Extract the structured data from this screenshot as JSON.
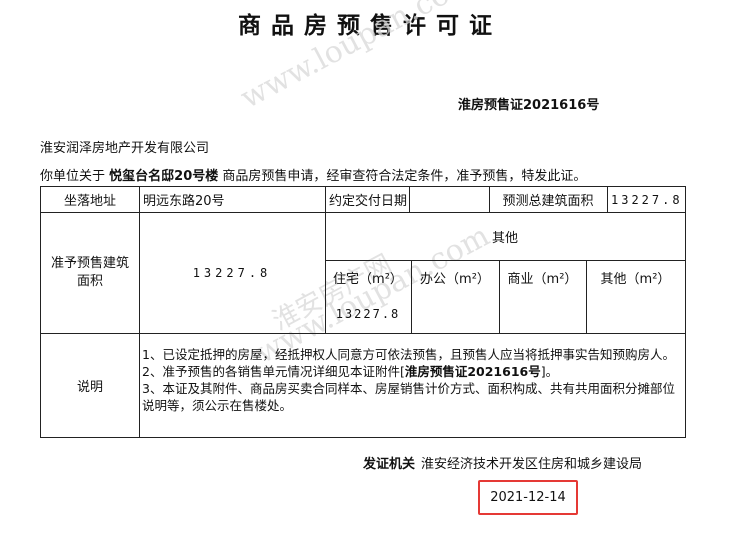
{
  "document": {
    "title": "商品房预售许可证",
    "cert_number": "淮房预售证2021616号",
    "company": "淮安润泽房地产开发有限公司",
    "intro_prefix": "你单位关于",
    "project": "悦玺台名邸20号楼",
    "intro_suffix": "商品房预售申请，经审查符合法定条件，准予预售，特发此证。"
  },
  "table": {
    "location_label": "坐落地址",
    "location_value": "明远东路20号",
    "delivery_label": "约定交付日期",
    "delivery_value": "",
    "total_area_label": "预测总建筑面积",
    "total_area_value": "13227.8",
    "approved_area_label": "准予预售建筑面积",
    "approved_area_value": "13227.8",
    "other_label": "其他",
    "residential_label": "住宅（m²）",
    "office_label": "办公（m²）",
    "commercial_label": "商业（m²）",
    "others_label": "其他（m²）",
    "residential_value": "13227.8",
    "office_value": "",
    "commercial_value": "",
    "others_value": "",
    "notes_label": "说明",
    "note1": "1、已设定抵押的房屋，经抵押权人同意方可依法预售，且预售人应当将抵押事实告知预购房人。",
    "note2_prefix": "2、准予预售的各销售单元情况详细见本证附件[",
    "note2_bold": "淮房预售证2021616号",
    "note2_suffix": "]。",
    "note3": "3、本证及其附件、商品房买卖合同样本、房屋销售计价方式、面积构成、共有共用面积分摊部位说明等，须公示在售楼处。"
  },
  "footer": {
    "issuer_label": "发证机关",
    "issuer_value": "淮安经济技术开发区住房和城乡建设局",
    "date": "2021-12-14"
  },
  "watermark": {
    "text1": "www.loupan.com",
    "text2": "www.loupan.com",
    "text3": "淮安房产网"
  },
  "colors": {
    "highlight_border": "#e53935",
    "watermark": "#d9d9d9"
  }
}
